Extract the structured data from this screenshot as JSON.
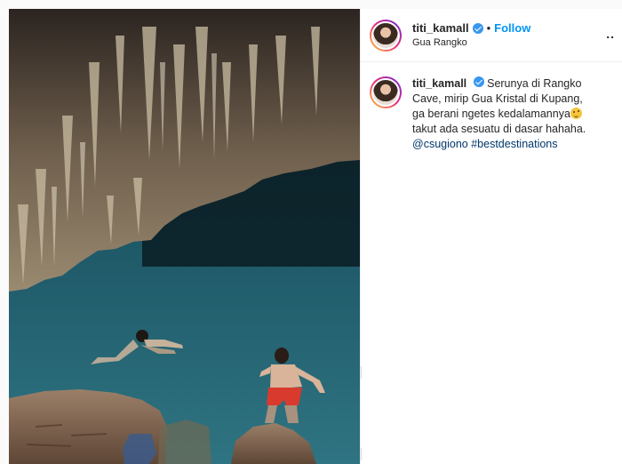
{
  "post": {
    "username": "titi_kamall",
    "follow_label": "Follow",
    "separator": "•",
    "location": "Gua Rangko",
    "more_label": "..",
    "caption": {
      "username": "titi_kamall",
      "text_before_emoji": "Serunya di Rangko Cave, mirip Gua Kristal di Kupang, ga berani ngetes kedalamannya",
      "text_after_emoji": " takut ada sesuatu di dasar hahaha.",
      "mention": "@csugiono",
      "hashtag": "#bestdestinations"
    }
  },
  "colors": {
    "verified": "#3897f0",
    "follow": "#0095f6",
    "link": "#00376b",
    "water": "#2a6c7a"
  }
}
